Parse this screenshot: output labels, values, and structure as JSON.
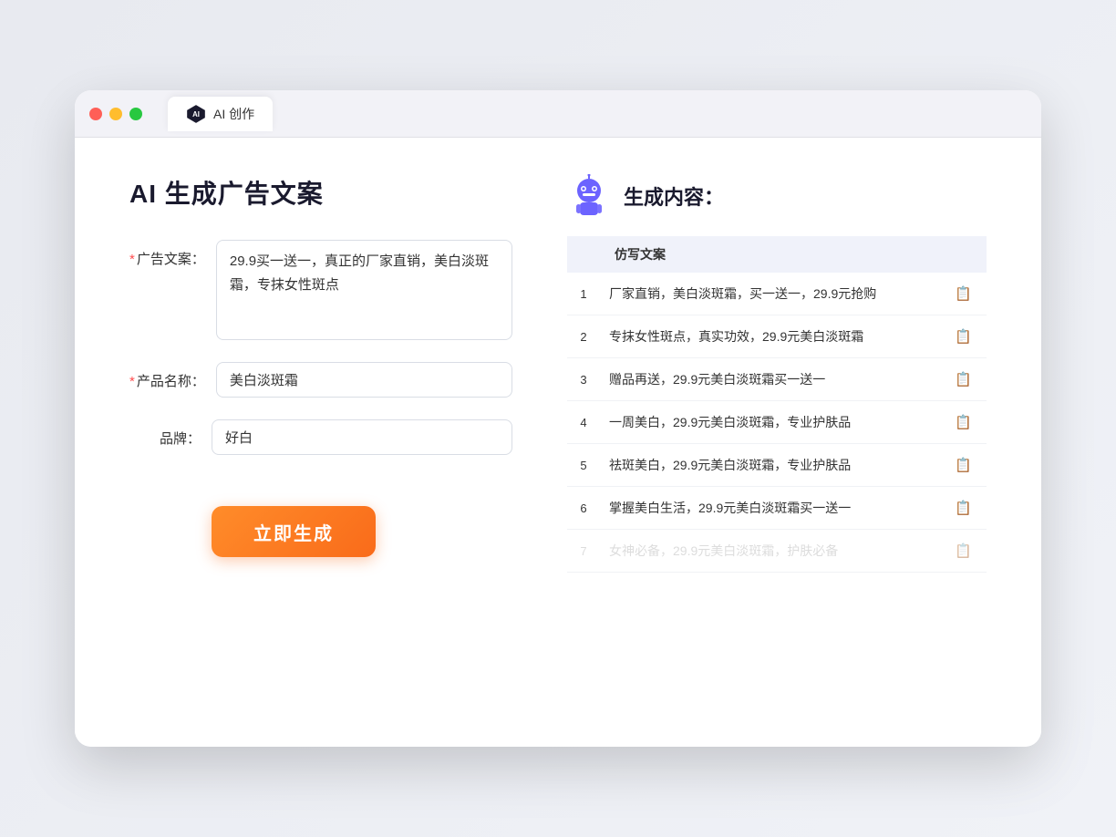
{
  "browser": {
    "tab_label": "AI 创作"
  },
  "page": {
    "title": "AI 生成广告文案",
    "form": {
      "ad_copy_label": "广告文案：",
      "ad_copy_required": "*",
      "ad_copy_value": "29.9买一送一，真正的厂家直销，美白淡斑霜，专抹女性斑点",
      "product_name_label": "产品名称：",
      "product_name_required": "*",
      "product_name_value": "美白淡斑霜",
      "brand_label": "品牌：",
      "brand_value": "好白",
      "generate_button": "立即生成"
    },
    "results": {
      "header_icon": "robot",
      "header_title": "生成内容：",
      "table_header": "仿写文案",
      "items": [
        {
          "num": 1,
          "text": "厂家直销，美白淡斑霜，买一送一，29.9元抢购"
        },
        {
          "num": 2,
          "text": "专抹女性斑点，真实功效，29.9元美白淡斑霜"
        },
        {
          "num": 3,
          "text": "赠品再送，29.9元美白淡斑霜买一送一"
        },
        {
          "num": 4,
          "text": "一周美白，29.9元美白淡斑霜，专业护肤品"
        },
        {
          "num": 5,
          "text": "祛斑美白，29.9元美白淡斑霜，专业护肤品"
        },
        {
          "num": 6,
          "text": "掌握美白生活，29.9元美白淡斑霜买一送一"
        },
        {
          "num": 7,
          "text": "女神必备，29.9元美白淡斑霜，护肤必备",
          "faded": true
        }
      ]
    }
  }
}
